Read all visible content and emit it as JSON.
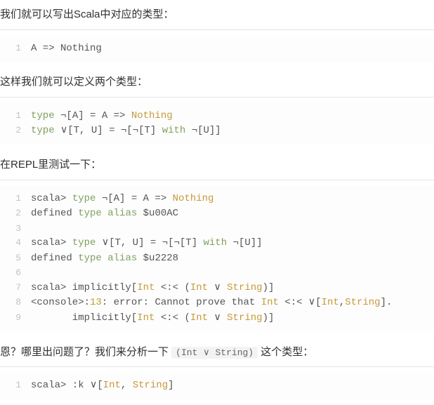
{
  "para1": "我们就可以写出Scala中对应的类型：",
  "code1": {
    "lines": [
      {
        "n": "1",
        "plain": "A => Nothing"
      }
    ]
  },
  "para2": "这样我们就可以定义两个类型：",
  "code2": {
    "lines": [
      {
        "n": "1",
        "tokens": [
          [
            "kw",
            "type"
          ],
          [
            "sym",
            " ¬[A] = A => "
          ],
          [
            "type",
            "Nothing"
          ]
        ]
      },
      {
        "n": "2",
        "tokens": [
          [
            "kw",
            "type"
          ],
          [
            "sym",
            " ∨[T, U] = ¬[¬[T] "
          ],
          [
            "kw",
            "with"
          ],
          [
            "sym",
            " ¬[U]]"
          ]
        ]
      }
    ]
  },
  "para3": "在REPL里测试一下：",
  "code3": {
    "lines": [
      {
        "n": "1",
        "tokens": [
          [
            "sym",
            "scala> "
          ],
          [
            "kw",
            "type"
          ],
          [
            "sym",
            " ¬[A] = A => "
          ],
          [
            "type",
            "Nothing"
          ]
        ]
      },
      {
        "n": "2",
        "tokens": [
          [
            "sym",
            "defined "
          ],
          [
            "kw",
            "type"
          ],
          [
            "sym",
            " "
          ],
          [
            "kw",
            "alias"
          ],
          [
            "sym",
            " $u00AC"
          ]
        ]
      },
      {
        "n": "3",
        "tokens": [
          [
            "sym",
            ""
          ]
        ]
      },
      {
        "n": "4",
        "tokens": [
          [
            "sym",
            "scala> "
          ],
          [
            "kw",
            "type"
          ],
          [
            "sym",
            " ∨[T, U] = ¬[¬[T] "
          ],
          [
            "kw",
            "with"
          ],
          [
            "sym",
            " ¬[U]]"
          ]
        ]
      },
      {
        "n": "5",
        "tokens": [
          [
            "sym",
            "defined "
          ],
          [
            "kw",
            "type"
          ],
          [
            "sym",
            " "
          ],
          [
            "kw",
            "alias"
          ],
          [
            "sym",
            " $u2228"
          ]
        ]
      },
      {
        "n": "6",
        "tokens": [
          [
            "sym",
            ""
          ]
        ]
      },
      {
        "n": "7",
        "tokens": [
          [
            "sym",
            "scala> implicitly["
          ],
          [
            "type",
            "Int"
          ],
          [
            "sym",
            " <:< ("
          ],
          [
            "type",
            "Int"
          ],
          [
            "sym",
            " ∨ "
          ],
          [
            "type",
            "String"
          ],
          [
            "sym",
            ")]"
          ]
        ]
      },
      {
        "n": "8",
        "tokens": [
          [
            "sym",
            "<console>:"
          ],
          [
            "num",
            "13"
          ],
          [
            "sym",
            ": error: Cannot prove that "
          ],
          [
            "type",
            "Int"
          ],
          [
            "sym",
            " <:< ∨["
          ],
          [
            "type",
            "Int"
          ],
          [
            "sym",
            ","
          ],
          [
            "type",
            "String"
          ],
          [
            "sym",
            "]."
          ]
        ]
      },
      {
        "n": "9",
        "tokens": [
          [
            "sym",
            "       implicitly["
          ],
          [
            "type",
            "Int"
          ],
          [
            "sym",
            " <:< ("
          ],
          [
            "type",
            "Int"
          ],
          [
            "sym",
            " ∨ "
          ],
          [
            "type",
            "String"
          ],
          [
            "sym",
            ")]"
          ]
        ]
      }
    ]
  },
  "para4_pre": "恩？哪里出问题了？我们来分析一下 ",
  "para4_code": "(Int ∨ String)",
  "para4_post": " 这个类型：",
  "code4": {
    "lines": [
      {
        "n": "1",
        "tokens": [
          [
            "sym",
            "scala> :k ∨["
          ],
          [
            "type",
            "Int"
          ],
          [
            "sym",
            ", "
          ],
          [
            "type",
            "String"
          ],
          [
            "sym",
            "]"
          ]
        ]
      }
    ]
  }
}
